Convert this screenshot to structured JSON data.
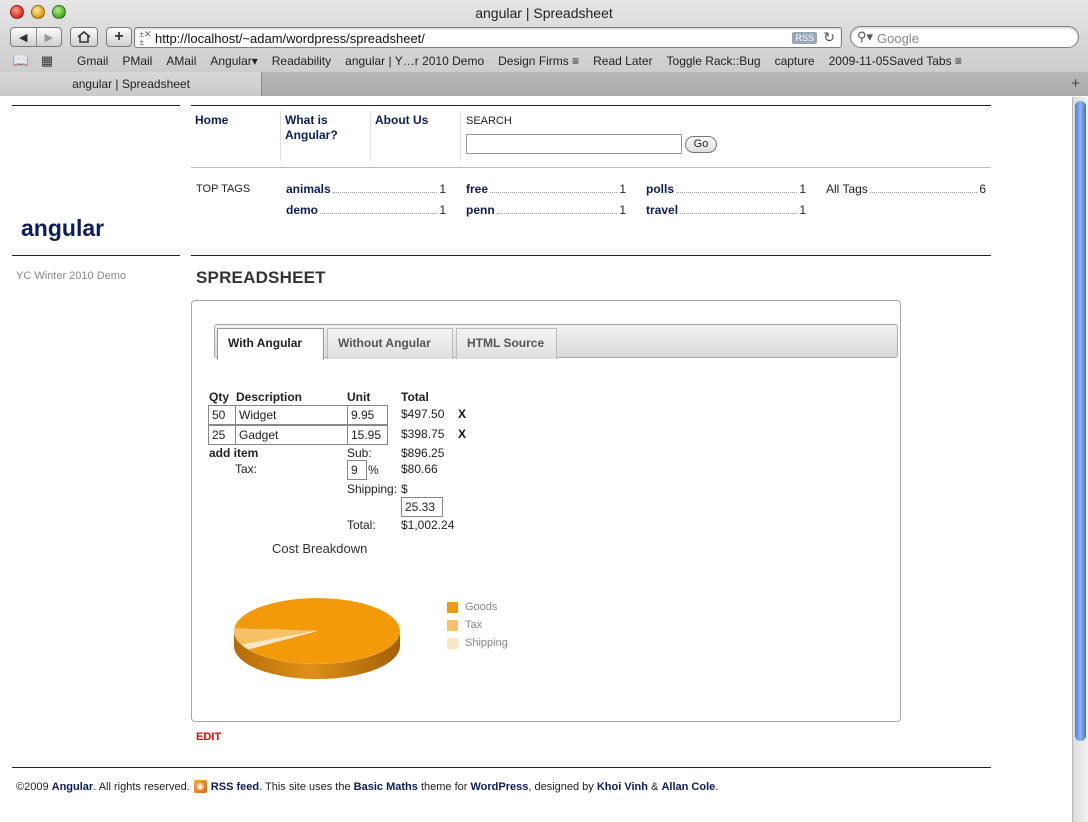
{
  "window": {
    "title": "angular | Spreadsheet"
  },
  "toolbar": {
    "url": "http://localhost/~adam/wordpress/spreadsheet/",
    "rss_badge": "RSS",
    "search_placeholder": "Google",
    "back_icon": "back-arrow-icon",
    "forward_icon": "forward-arrow-icon",
    "home_icon": "home-icon",
    "add_icon": "plus-icon",
    "reload_icon": "reload-icon"
  },
  "bookmarks": [
    "Gmail",
    "PMail",
    "AMail",
    "Angular▾",
    "Readability",
    "angular | Y…r 2010 Demo",
    "Design Firms ≡",
    "Read Later",
    "Toggle Rack::Bug",
    "capture",
    "2009-11-05Saved Tabs ≡"
  ],
  "tab": {
    "label": "angular | Spreadsheet"
  },
  "site": {
    "title": "angular",
    "description": "YC Winter 2010 Demo",
    "nav": [
      {
        "label": "Home"
      },
      {
        "label": "What is Angular?"
      },
      {
        "label": "About Us"
      }
    ],
    "search_label": "SEARCH",
    "search_value": "",
    "go_label": "Go",
    "top_tags_label": "TOP TAGS",
    "tags": [
      {
        "name": "animals",
        "count": "1"
      },
      {
        "name": "free",
        "count": "1"
      },
      {
        "name": "polls",
        "count": "1"
      },
      {
        "name": "All Tags",
        "count": "6"
      },
      {
        "name": "demo",
        "count": "1"
      },
      {
        "name": "penn",
        "count": "1"
      },
      {
        "name": "travel",
        "count": "1"
      }
    ]
  },
  "page": {
    "heading": "SPREADSHEET",
    "tabs": [
      "With Angular",
      "Without Angular",
      "HTML Source"
    ],
    "active_tab": "With Angular",
    "edit_label": "EDIT"
  },
  "sheet": {
    "headers": {
      "qty": "Qty",
      "description": "Description",
      "unit": "Unit",
      "total": "Total"
    },
    "rows": [
      {
        "qty": "50",
        "description": "Widget",
        "unit": "9.95",
        "total": "$497.50",
        "delete": "X"
      },
      {
        "qty": "25",
        "description": "Gadget",
        "unit": "15.95",
        "total": "$398.75",
        "delete": "X"
      }
    ],
    "add_item_label": "add item",
    "sub_label": "Sub:",
    "sub_value": "$896.25",
    "tax_label": "Tax:",
    "tax_rate": "9",
    "tax_pct": "%",
    "tax_value": "$80.66",
    "shipping_label": "Shipping:",
    "shipping_currency": "$",
    "shipping_value": "25.33",
    "total_label": "Total:",
    "total_value": "$1,002.24"
  },
  "chart_data": {
    "type": "pie",
    "title": "Cost Breakdown",
    "categories": [
      "Goods",
      "Tax",
      "Shipping"
    ],
    "values": [
      896.25,
      80.66,
      25.33
    ],
    "colors": [
      "#f39a0a",
      "#f7c165",
      "#fbe6c3"
    ],
    "legend": "right"
  },
  "footer": {
    "copyright": "©2009",
    "brand": "Angular",
    "rights": ". All rights reserved.",
    "rss_feed": "RSS feed",
    "theme_pre": ". This site uses the",
    "theme_name": "Basic Maths",
    "theme_mid": "theme for",
    "platform": "WordPress",
    "designed_by": ", designed by",
    "designer1": "Khoi Vinh",
    "amp": "&",
    "designer2": "Allan Cole",
    "end": "."
  },
  "colors": {
    "link": "#0b1d5c",
    "edit": "#ee0000",
    "scroll_accent": "#4a7fd6"
  }
}
